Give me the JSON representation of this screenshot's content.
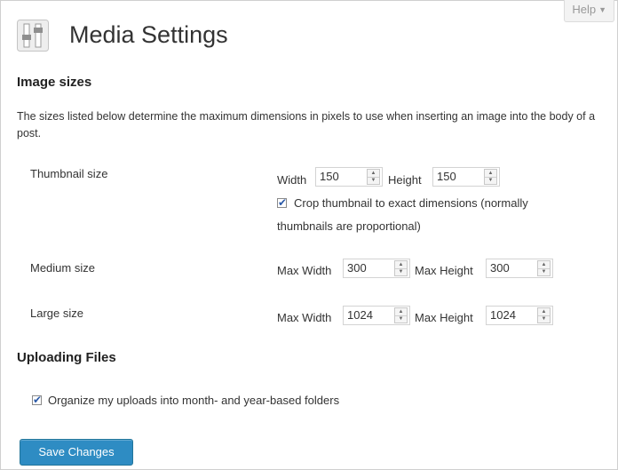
{
  "header": {
    "title": "Media Settings",
    "help_label": "Help",
    "help_arrow": "▼"
  },
  "image_sizes": {
    "heading": "Image sizes",
    "description": "The sizes listed below determine the maximum dimensions in pixels to use when inserting an image into the body of a post.",
    "thumbnail": {
      "label": "Thumbnail size",
      "width_label": "Width",
      "width_value": "150",
      "height_label": "Height",
      "height_value": "150",
      "crop_checked": true,
      "crop_label_line1": "Crop thumbnail to exact dimensions (normally",
      "crop_label_line2": "thumbnails are proportional)"
    },
    "medium": {
      "label": "Medium size",
      "max_width_label": "Max Width",
      "max_width_value": "300",
      "max_height_label": "Max Height",
      "max_height_value": "300"
    },
    "large": {
      "label": "Large size",
      "max_width_label": "Max Width",
      "max_width_value": "1024",
      "max_height_label": "Max Height",
      "max_height_value": "1024"
    }
  },
  "uploading": {
    "heading": "Uploading Files",
    "organize_checked": true,
    "organize_label": "Organize my uploads into month- and year-based folders"
  },
  "actions": {
    "save_label": "Save Changes"
  },
  "colors": {
    "accent": "#2e8cc3",
    "checkmark": "#2b5aa8"
  }
}
